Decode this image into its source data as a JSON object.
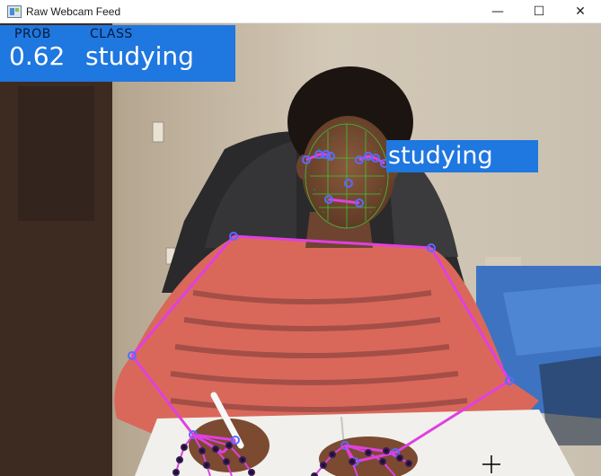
{
  "window": {
    "title": "Raw Webcam Feed",
    "controls": {
      "minimize": "—",
      "maximize": "☐",
      "close": "✕"
    },
    "app_icon": "webcam-window-icon"
  },
  "overlay": {
    "prob_header": "PROB",
    "class_header": "CLASS",
    "prob_value": "0.62",
    "class_value": "studying",
    "box_color": "#1f77e0"
  },
  "face_label": {
    "text": "studying"
  },
  "landmarks": {
    "pose_color": "#e040e0",
    "joint_color": "#5a6aff",
    "face_mesh_color": "#3ad13a"
  }
}
